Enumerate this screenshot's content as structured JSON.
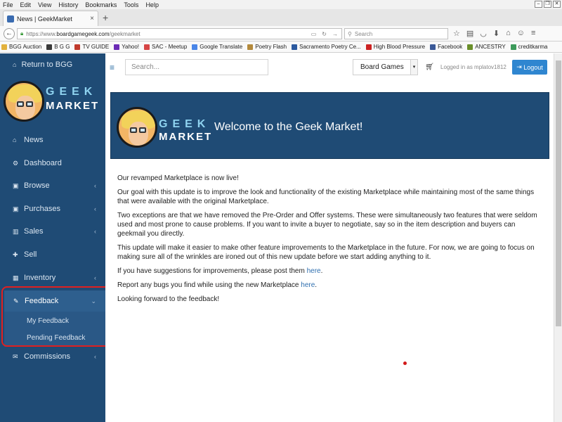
{
  "browser": {
    "menu": [
      "File",
      "Edit",
      "View",
      "History",
      "Bookmarks",
      "Tools",
      "Help"
    ],
    "tab_title": "News | GeekMarket",
    "url_prefix": "https://www.",
    "url_host": "boardgamegeek.com",
    "url_path": "/geekmarket",
    "search_placeholder": "Search",
    "bookmarks": [
      {
        "label": "BGG Auction",
        "color": "#e2b13c"
      },
      {
        "label": "B G G",
        "color": "#3a3a3a"
      },
      {
        "label": "TV GUIDE",
        "color": "#c0392b"
      },
      {
        "label": "Yahoo!",
        "color": "#6b2bb5"
      },
      {
        "label": "SAC - Meetup",
        "color": "#d64545"
      },
      {
        "label": "Google Translate",
        "color": "#4a86e8"
      },
      {
        "label": "Poetry Flash",
        "color": "#b48a3c"
      },
      {
        "label": "Sacramento Poetry Ce...",
        "color": "#2c5aa0"
      },
      {
        "label": "High Blood Pressure",
        "color": "#cc2222"
      },
      {
        "label": "Facebook",
        "color": "#3b5998"
      },
      {
        "label": "ANCESTRY",
        "color": "#6a8f2a"
      },
      {
        "label": "creditkarma",
        "color": "#3c9a5a"
      }
    ]
  },
  "sidebar": {
    "return_label": "Return to BGG",
    "logo_line1": "GEEK",
    "logo_line2": "MARKET",
    "items": [
      {
        "label": "News"
      },
      {
        "label": "Dashboard"
      },
      {
        "label": "Browse"
      },
      {
        "label": "Purchases"
      },
      {
        "label": "Sales"
      },
      {
        "label": "Sell"
      },
      {
        "label": "Inventory"
      },
      {
        "label": "Feedback"
      },
      {
        "label": "Commissions"
      }
    ],
    "feedback_sub": [
      "My Feedback",
      "Pending Feedback"
    ]
  },
  "header": {
    "search_placeholder": "Search...",
    "category_selected": "Board Games",
    "logged_in_text": "Logged in as mplatov1812",
    "logout_label": "Logout"
  },
  "banner": {
    "title": "Welcome to the Geek Market!"
  },
  "content": {
    "p1": "Our revamped Marketplace is now live!",
    "p2": "Our goal with this update is to improve the look and functionality of the existing Marketplace while maintaining most of the same things that were available with the original Marketplace.",
    "p3": "Two exceptions are that we have removed the Pre-Order and Offer systems. These were simultaneously two features that were seldom used and most prone to cause problems. If you want to invite a buyer to negotiate, say so in the item description and buyers can geekmail you directly.",
    "p4": "This update will make it easier to make other feature improvements to the Marketplace in the future. For now, we are going to focus on making sure all of the wrinkles are ironed out of this new update before we start adding anything to it.",
    "p5_text": "If you have suggestions for improvements, please post them ",
    "p5_link": "here",
    "p6_text": "Report any bugs you find while using the new Marketplace ",
    "p6_link": "here",
    "p7": "Looking forward to the feedback!",
    "link_suffix": "."
  }
}
